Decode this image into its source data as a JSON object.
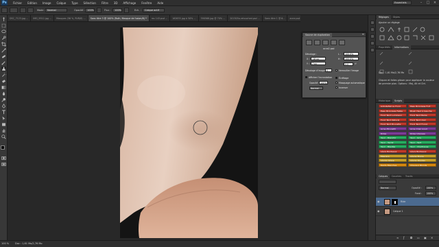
{
  "app": {
    "logo": "Ps"
  },
  "menu": [
    "Fichier",
    "Edition",
    "Image",
    "Calque",
    "Type",
    "Sélection",
    "Filtre",
    "3D",
    "Affichage",
    "Fenêtre",
    "Aide"
  ],
  "workspace": "Essentiels",
  "options": {
    "mode_label": "Mode :",
    "mode_value": "Normal",
    "opacity_label": "Opacité :",
    "opacity_value": "100%",
    "flow_label": "Flux :",
    "flow_value": "100%",
    "sample_label": "Ech. :",
    "sample_value": "Calque actif"
  },
  "tabs": [
    {
      "label": "DSC_7123.jpg ...",
      "active": false
    },
    {
      "label": "IMG_9512.jpg ...",
      "active": false
    },
    {
      "label": "Masques (56 %, RVB/8) ...",
      "active": false
    },
    {
      "label": "Sans titre 3 @ 100% (Ruth, Masque de fusion/8) *",
      "active": true
    },
    {
      "label": "ms 143.psd ...",
      "active": false
    },
    {
      "label": "162635.jpg à 50% ...",
      "active": false
    },
    {
      "label": "390568.jpg @ 70% ...",
      "active": false
    },
    {
      "label": "201505a-retouched.psd ...",
      "active": false
    },
    {
      "label": "Sans titre 1 @ 6...",
      "active": false
    },
    {
      "label": "acne.psd @ 50...",
      "active": false
    }
  ],
  "clone_source": {
    "tab": "Source de duplication",
    "filename": "acne2.psd",
    "offset_label": "Décalage :",
    "x_label": "X :",
    "x_value": "-18 px",
    "y_label": "Y :",
    "y_value": "7 px",
    "w_label": "L :",
    "w_value": "100,0%",
    "h_label": "H :",
    "h_value": "100,0%",
    "angle_value": "0,0",
    "frame_offset_label": "Décalage d'image :",
    "frame_offset_value": "0",
    "lock_frame_label": "Verrouiller l'image",
    "overlay_label": "Afficher l'incrustation",
    "opacity_label": "Opacité :",
    "opacity_value": "100%",
    "mode_value": "Normal",
    "clipped_label": "Écrêtage",
    "autohide_label": "Masquage automatique",
    "invert_label": "Inverser"
  },
  "adjust_panel": {
    "tabs": [
      "Réglages",
      "Styles"
    ],
    "title": "Ajouter un réglage"
  },
  "properties_panel": {
    "tabs": [
      "Propriétés",
      "Informations"
    ],
    "text": [
      "Cliquez et faites glisser pour appliquer la couleur",
      "de premier plan. Options : Maj, Alt et Ctrl."
    ],
    "doc_label": "Doc : 1,61 Mo/2,76 Mo"
  },
  "actions_panel": {
    "tabs": [
      "Historique",
      "Scripts"
    ],
    "items": [
      {
        "label": "Anti-Reflet ou Fond",
        "color": "#c0392b"
      },
      {
        "label": "Peau Bronzage Fort",
        "color": "#c0392b"
      },
      {
        "label": "Peau Bronzage Faible",
        "color": "#c0392b"
      },
      {
        "label": "Blush Haut à Gauche",
        "color": "#c0392b"
      },
      {
        "label": "Fond Teint Lumineux",
        "color": "#c0392b"
      },
      {
        "label": "Fond Teint Beige",
        "color": "#c0392b"
      },
      {
        "label": "Fond Teint Naturel",
        "color": "#c0392b"
      },
      {
        "label": "Fond Teint Clair",
        "color": "#c0392b"
      },
      {
        "label": "Fond Teint Brunette",
        "color": "#c0392b"
      },
      {
        "label": "Fond Teint Foncé",
        "color": "#c0392b"
      },
      {
        "label": "Acne (Brunett)",
        "color": "#7d3c98"
      },
      {
        "label": "Acne (Clair pour)",
        "color": "#7d3c98"
      },
      {
        "label": "Rides",
        "color": "#7d3c98"
      },
      {
        "label": "Rides Intenses",
        "color": "#7d3c98"
      },
      {
        "label": "Yeux - Blanchir",
        "color": "#27ae60"
      },
      {
        "label": "Yeux - Gris",
        "color": "#27ae60"
      },
      {
        "label": "Yeux - Verdir",
        "color": "#27ae60"
      },
      {
        "label": "Yeux - Vert",
        "color": "#27ae60"
      },
      {
        "label": "Yeux - Bleutés",
        "color": "#27ae60"
      },
      {
        "label": "Yeux - Chartreuse",
        "color": "#27ae60"
      },
      {
        "label": "Lèvre Bordeaux",
        "color": "#c0392b"
      },
      {
        "label": "Lèvre Bordeaux",
        "color": "#c0392b"
      },
      {
        "label": "Mascara",
        "color": "#c8a12a"
      },
      {
        "label": "Lèvres Brune",
        "color": "#c8a12a"
      },
      {
        "label": "Lèvres Glisse",
        "color": "#c8a12a"
      },
      {
        "label": "Lèvres Rouges",
        "color": "#c8a12a"
      },
      {
        "label": "Dents Blanches",
        "color": "#d68910"
      },
      {
        "label": "Cheveux Blonds",
        "color": "#d68910"
      }
    ]
  },
  "layers_panel": {
    "tabs": [
      "Calques",
      "Couches",
      "Tracés"
    ],
    "blend_value": "Normal",
    "opacity_label": "Opacité :",
    "opacity_value": "100%",
    "fill_label": "Fond :",
    "fill_value": "100%",
    "layers": [
      {
        "name": "Ride",
        "selected": true
      },
      {
        "name": "Calque 1",
        "selected": false
      }
    ]
  },
  "status": {
    "zoom": "100 %",
    "doc": "Doc : 1,61 Mo/2,76 Mo"
  },
  "colors": {
    "skin_light": "#e6c9b6",
    "skin_dark": "#b98b73",
    "panel": "#535353"
  }
}
